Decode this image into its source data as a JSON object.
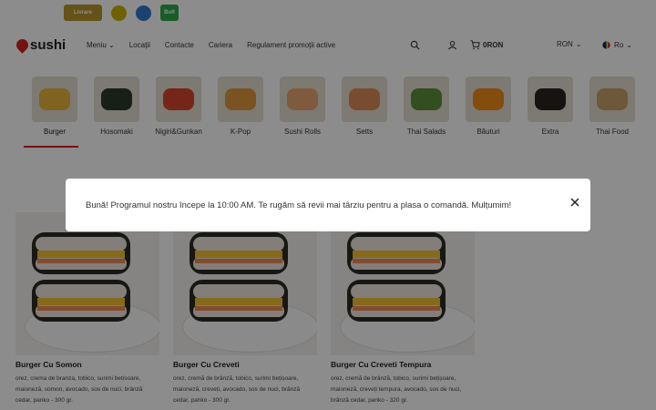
{
  "topbar": {
    "badges": [
      "Livrare",
      "",
      "",
      "Bolt"
    ]
  },
  "header": {
    "logo_text": "sushi",
    "menu": [
      "Meniu",
      "Locații",
      "Contacte",
      "Cariera",
      "Regulament promoții active"
    ],
    "cart_total": "0RON",
    "currency": "RON",
    "language": "Ro"
  },
  "categories": [
    {
      "label": "Burger",
      "color": "#e9b33d"
    },
    {
      "label": "Hosomaki",
      "color": "#2c3a28"
    },
    {
      "label": "Nigiri&Gunkan",
      "color": "#d8452b"
    },
    {
      "label": "K-Pop",
      "color": "#e0983f"
    },
    {
      "label": "Sushi Rolls",
      "color": "#e8a772"
    },
    {
      "label": "Setts",
      "color": "#dd8a56"
    },
    {
      "label": "Thai Salads",
      "color": "#5d8f39"
    },
    {
      "label": "Băuturi",
      "color": "#f08a18"
    },
    {
      "label": "Extra",
      "color": "#2a2320"
    },
    {
      "label": "Thai Food",
      "color": "#c9a06a"
    }
  ],
  "products": [
    {
      "title": "Burger Cu Somon",
      "desc": "orez, crema de branza, tobico, surimi betisoare, maioneză, somon, avocado, sos de nuci, brânză cedar, panko - 300 gr."
    },
    {
      "title": "Burger Cu Creveti",
      "desc": "orez, cremă de brânză, tobico, surimi bețișoare, maioneză, creveți, avocado, sos de nuci, brânză cedar, panko - 300 gr."
    },
    {
      "title": "Burger Cu Creveti Tempura",
      "desc": "orez, cremă de brânză, tobico, surimi bețișoare, maioneză, creveți tempura, avocado, sos de nuci, brânză cedar, panko - 320 gr."
    }
  ],
  "modal": {
    "message": "Bună! Programul nostru începe la 10:00 AM. Te rugăm să revii mai târziu pentru a plasa o comandă. Mulțumim!"
  }
}
